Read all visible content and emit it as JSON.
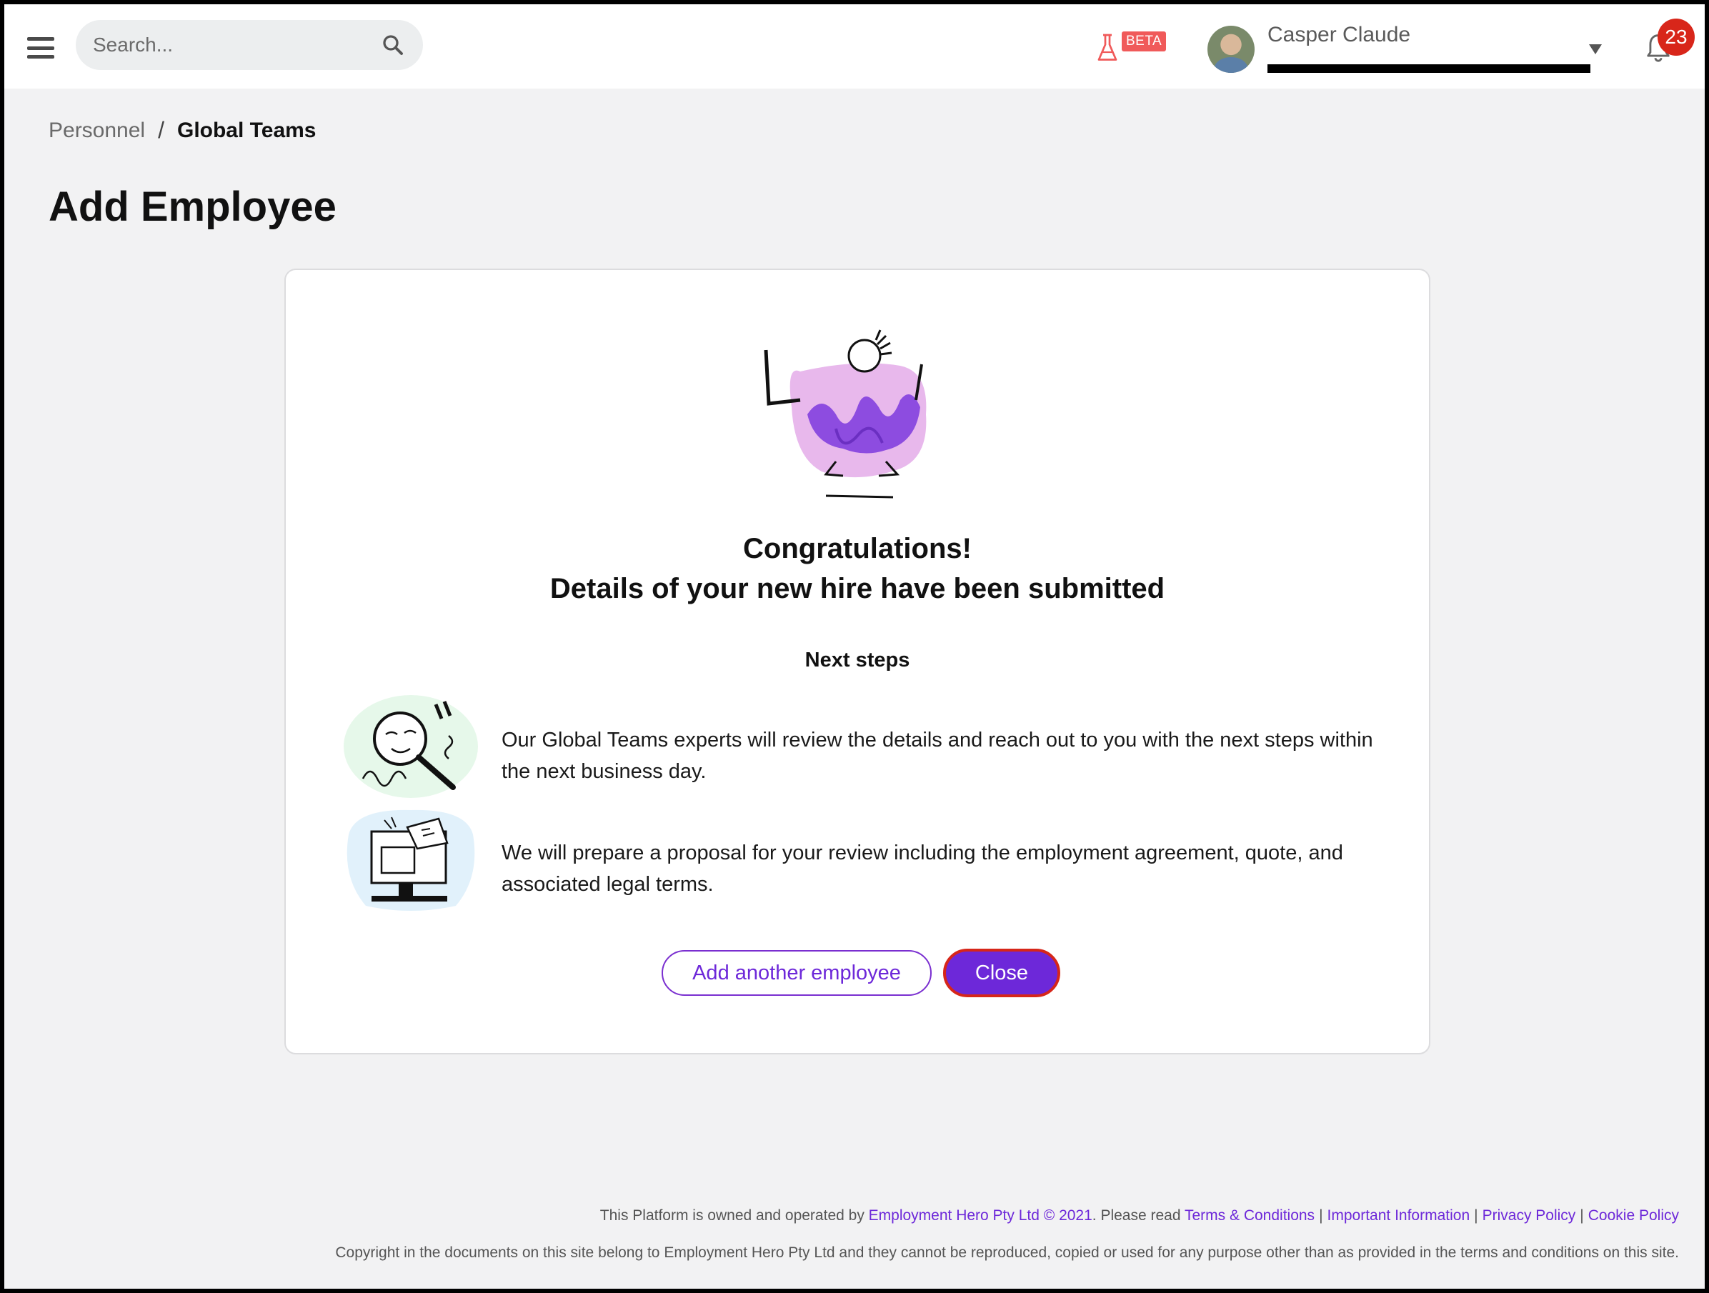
{
  "header": {
    "search_placeholder": "Search...",
    "beta_label": "BETA",
    "user_name": "Casper Claude",
    "notification_count": "23"
  },
  "breadcrumb": {
    "parent": "Personnel",
    "separator": "/",
    "current": "Global Teams"
  },
  "page": {
    "title": "Add Employee"
  },
  "card": {
    "heading_line1": "Congratulations!",
    "heading_line2": "Details of your new hire have been submitted",
    "next_steps_label": "Next steps",
    "steps": [
      {
        "icon": "magnifier-illustration",
        "text": "Our Global Teams experts will review the details and reach out to you with the next steps within the next business day."
      },
      {
        "icon": "computer-document-illustration",
        "text": "We will prepare a proposal for your review including the employment agreement, quote, and associated legal terms."
      }
    ],
    "add_another_label": "Add another employee",
    "close_label": "Close"
  },
  "footer": {
    "line1_prefix": "This Platform is owned and operated by ",
    "company_link": "Employment Hero Pty Ltd © 2021",
    "line1_middle": ". Please read ",
    "links": [
      "Terms & Conditions",
      "Important Information",
      "Privacy Policy",
      "Cookie Policy"
    ],
    "link_separator": "|",
    "line2": "Copyright in the documents on this site belong to Employment Hero Pty Ltd and they cannot be reproduced, copied or used for any purpose other than as provided in the terms and conditions on this site."
  },
  "colors": {
    "accent": "#6d28d9",
    "notification": "#d8261a",
    "beta": "#f05a5a",
    "background": "#f2f2f3"
  }
}
